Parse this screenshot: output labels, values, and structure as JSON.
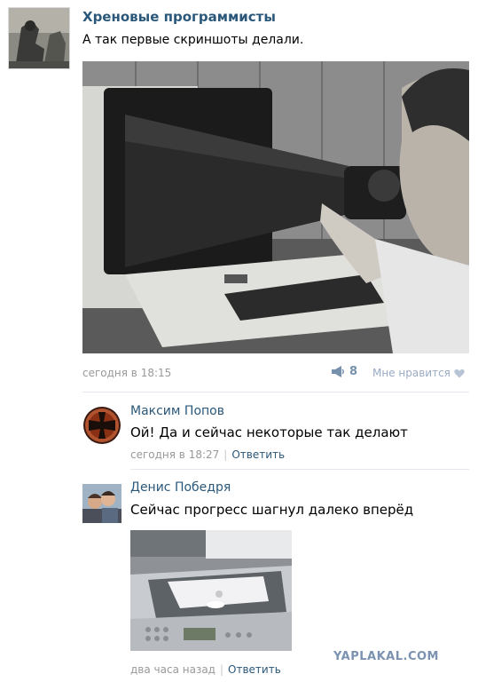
{
  "post": {
    "author": "Хреновые программисты",
    "text": "А так первые скриншоты делали.",
    "time": "сегодня в 18:15",
    "reposts": "8",
    "like_label": "Мне нравится"
  },
  "comments": [
    {
      "author": "Максим Попов",
      "text": "Ой! Да и сейчас некоторые так делают",
      "time": "сегодня в 18:27",
      "reply": "Ответить"
    },
    {
      "author": "Денис Победря",
      "text": "Сейчас прогресс шагнул далеко вперёд",
      "time": "два часа назад",
      "reply": "Ответить"
    }
  ],
  "watermark": "YAPLAKAL.COM",
  "icons": {
    "repost": "megaphone-icon",
    "like": "heart-icon"
  },
  "colors": {
    "link": "#2b587a",
    "meta": "#999999",
    "icon": "#7791ad"
  }
}
